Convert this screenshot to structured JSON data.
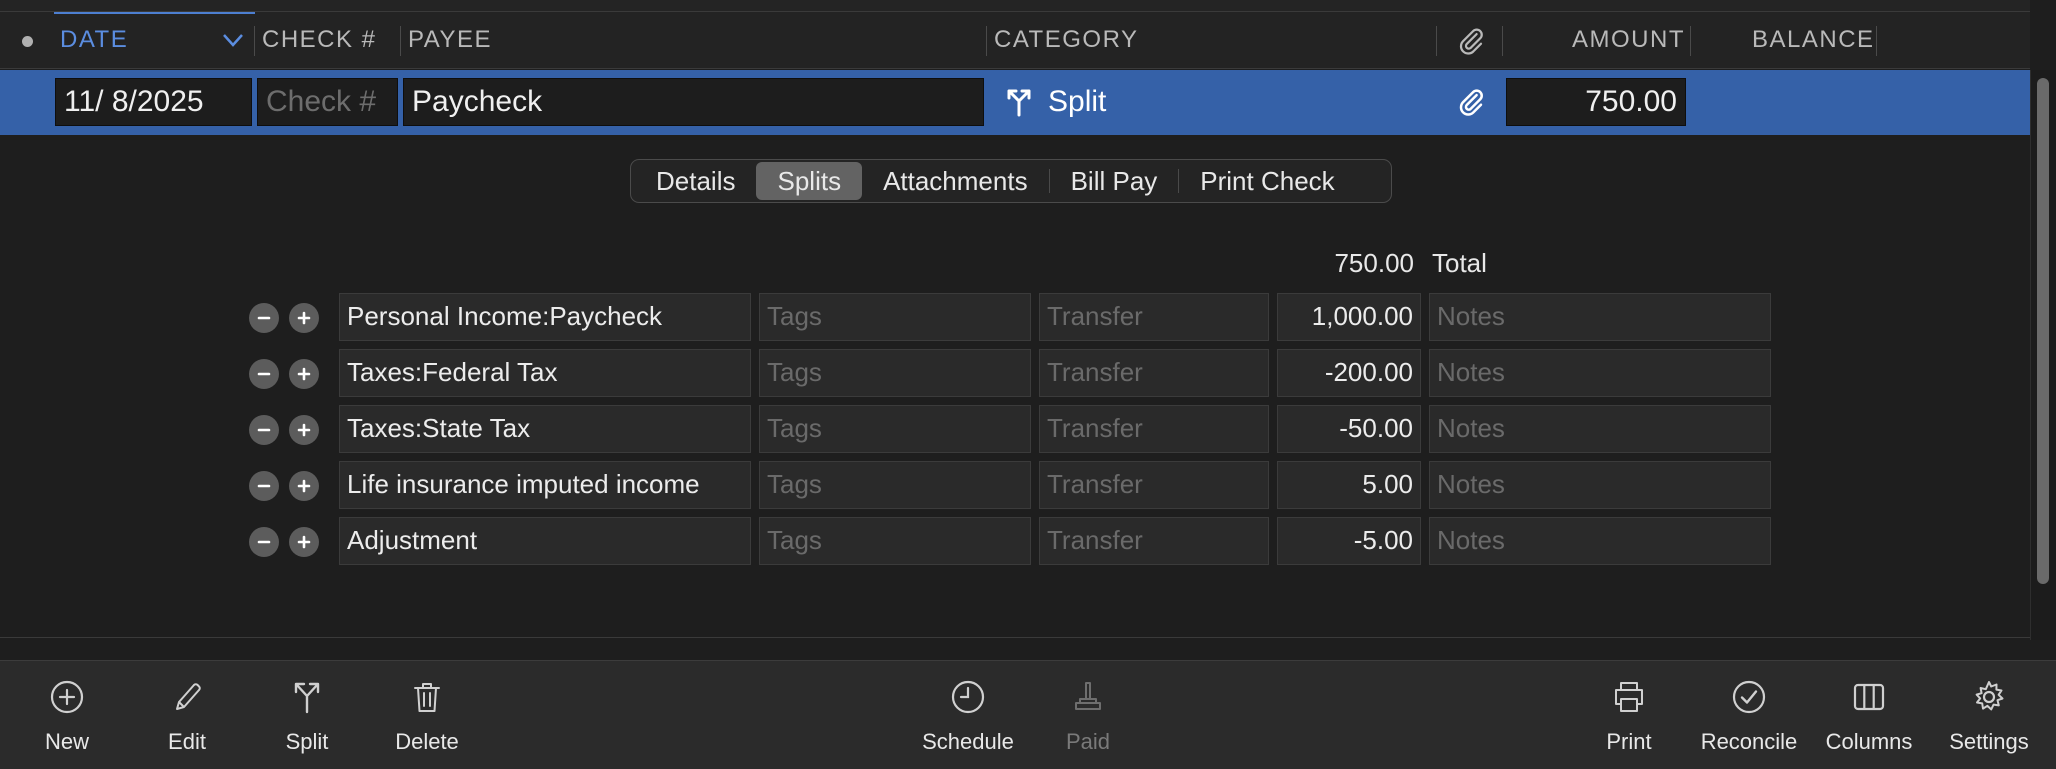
{
  "header": {
    "columns": {
      "date": "DATE",
      "check": "CHECK #",
      "payee": "PAYEE",
      "category": "CATEGORY",
      "amount": "AMOUNT",
      "balance": "BALANCE"
    },
    "sort_column": "date"
  },
  "transaction": {
    "date": "11/  8/2025",
    "check_placeholder": "Check #",
    "payee": "Paycheck",
    "category": "Split",
    "amount": "750.00"
  },
  "tabs": [
    "Details",
    "Splits",
    "Attachments",
    "Bill Pay",
    "Print Check"
  ],
  "active_tab": "Splits",
  "splits": {
    "total_value": "750.00",
    "total_label": "Total",
    "tags_placeholder": "Tags",
    "transfer_placeholder": "Transfer",
    "notes_placeholder": "Notes",
    "lines": [
      {
        "category": "Personal Income:Paycheck",
        "amount": "1,000.00"
      },
      {
        "category": "Taxes:Federal Tax",
        "amount": "-200.00"
      },
      {
        "category": "Taxes:State Tax",
        "amount": "-50.00"
      },
      {
        "category": "Life insurance imputed income",
        "amount": "5.00"
      },
      {
        "category": "Adjustment",
        "amount": "-5.00"
      }
    ]
  },
  "toolbar": {
    "new": "New",
    "edit": "Edit",
    "split": "Split",
    "delete": "Delete",
    "schedule": "Schedule",
    "paid": "Paid",
    "print": "Print",
    "reconcile": "Reconcile",
    "columns": "Columns",
    "settings": "Settings"
  },
  "icons": {
    "header_attachment": "paperclip-icon",
    "row_attachment": "paperclip-icon",
    "category_split": "split-arrow-icon",
    "sort_indicator": "chevron-down-icon",
    "remove_line": "minus-circle-icon",
    "add_line": "plus-circle-icon"
  },
  "colors": {
    "selection": "#3561a8",
    "accent": "#4d7fd1",
    "background": "#1e1e1e"
  }
}
